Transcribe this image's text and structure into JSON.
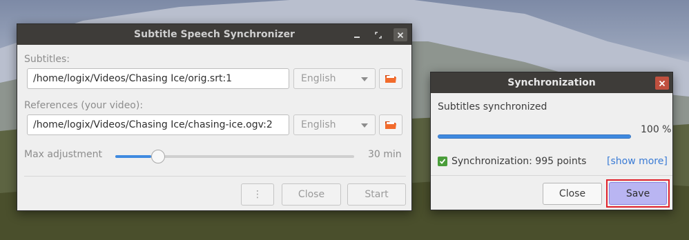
{
  "main_window": {
    "title": "Subtitle Speech Synchronizer",
    "subtitles_label": "Subtitles:",
    "subtitles_path": "/home/logix/Videos/Chasing Ice/orig.srt:1",
    "subtitles_language": "English",
    "references_label": "References (your video):",
    "references_path": "/home/logix/Videos/Chasing Ice/chasing-ice.ogv:2",
    "references_language": "English",
    "max_adjustment_label": "Max adjustment",
    "max_adjustment_value": "30 min",
    "slider_fraction": 0.15,
    "menu_button": "⋮",
    "close_button": "Close",
    "start_button": "Start"
  },
  "sync_dialog": {
    "title": "Synchronization",
    "status": "Subtitles synchronized",
    "progress_percent": 100,
    "progress_label": "100 %",
    "result_text": "Synchronization: 995 points",
    "show_more_link": "[show more]",
    "close_button": "Close",
    "save_button": "Save"
  },
  "icons": {
    "minimize": "minimize-icon",
    "maximize": "maximize-icon",
    "close": "close-icon",
    "folder": "folder-open-icon",
    "check": "checkbox-checked-icon"
  },
  "colors": {
    "accent": "#3f8ae0",
    "folder": "#e8561d",
    "check": "#4a9d3a",
    "highlight": "#e0202a",
    "save_bg": "#b9b5f2",
    "link": "#3a7bd5"
  }
}
